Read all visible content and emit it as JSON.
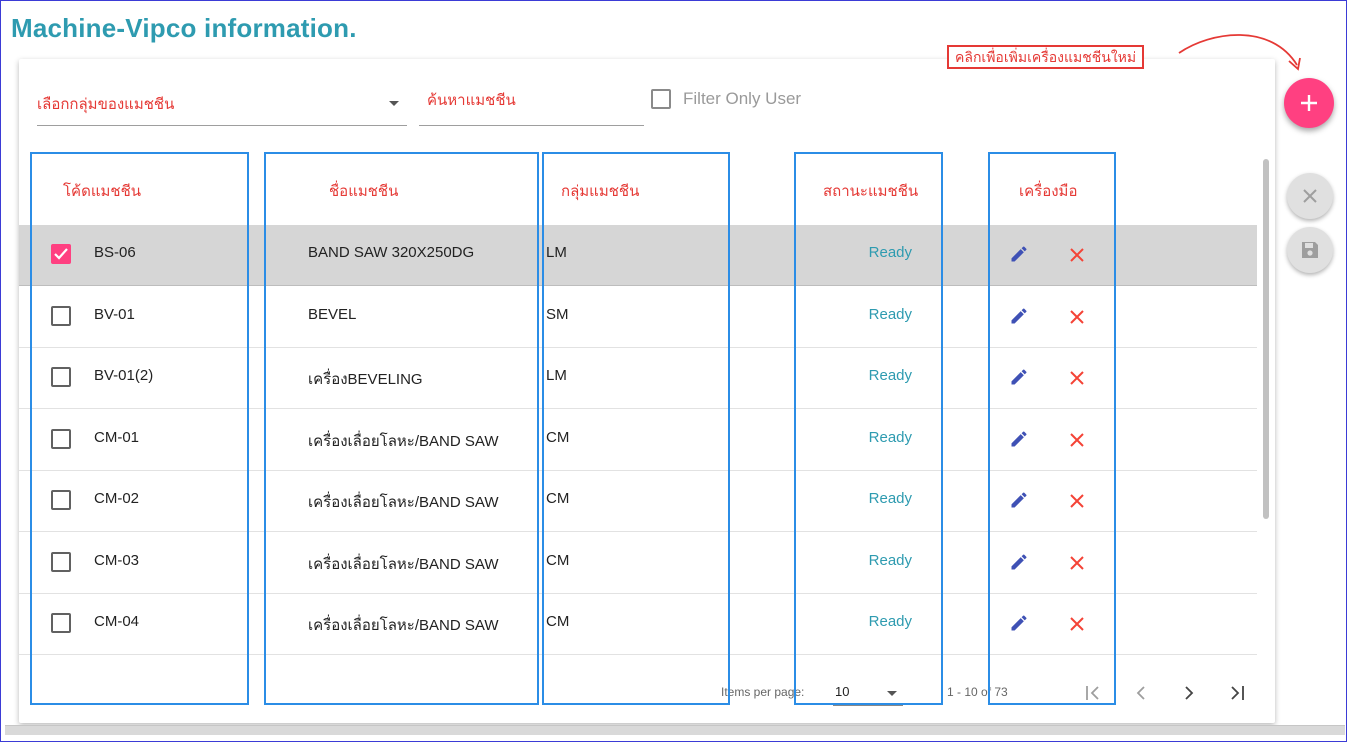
{
  "page": {
    "title": "Machine-Vipco information."
  },
  "filters": {
    "group_select_label": "เลือกกลุ่มของแมชชีน",
    "search_placeholder": "ค้นหาแมชชีน",
    "filter_only_user_label": "Filter Only User",
    "filter_only_user_checked": false
  },
  "table": {
    "headers": {
      "code": "โค้ดแมชชีน",
      "name": "ชื่อแมชชีน",
      "group": "กลุ่มแมชชีน",
      "status": "สถานะแมชชีน",
      "tools": "เครื่องมือ"
    },
    "rows": [
      {
        "selected": true,
        "code": "BS-06",
        "name": "BAND SAW 320X250DG",
        "group": "LM",
        "status": "Ready"
      },
      {
        "selected": false,
        "code": "BV-01",
        "name": "BEVEL",
        "group": "SM",
        "status": "Ready"
      },
      {
        "selected": false,
        "code": "BV-01(2)",
        "name": "เครื่องBEVELING",
        "group": "LM",
        "status": "Ready"
      },
      {
        "selected": false,
        "code": "CM-01",
        "name": "เครื่องเลื่อยโลหะ/BAND SAW",
        "group": "CM",
        "status": "Ready"
      },
      {
        "selected": false,
        "code": "CM-02",
        "name": "เครื่องเลื่อยโลหะ/BAND SAW",
        "group": "CM",
        "status": "Ready"
      },
      {
        "selected": false,
        "code": "CM-03",
        "name": "เครื่องเลื่อยโลหะ/BAND SAW",
        "group": "CM",
        "status": "Ready"
      },
      {
        "selected": false,
        "code": "CM-04",
        "name": "เครื่องเลื่อยโลหะ/BAND SAW",
        "group": "CM",
        "status": "Ready"
      }
    ]
  },
  "paginator": {
    "items_per_page_label": "Items per page:",
    "items_per_page_value": "10",
    "range_label": "1 - 10 of 73"
  },
  "actions": {
    "add_icon": "plus-icon",
    "cancel_icon": "close-icon",
    "save_icon": "save-icon"
  },
  "annotation": {
    "callout_text": "คลิกเพื่อเพิ่มเครื่องแมชชีนใหม่"
  },
  "colors": {
    "title": "#2e9bb0",
    "accent_pink": "#ff4081",
    "label_red": "#e53935",
    "status_teal": "#2e9bb0",
    "edit_icon": "#3f51b5",
    "highlight_box": "#2b8de6"
  }
}
